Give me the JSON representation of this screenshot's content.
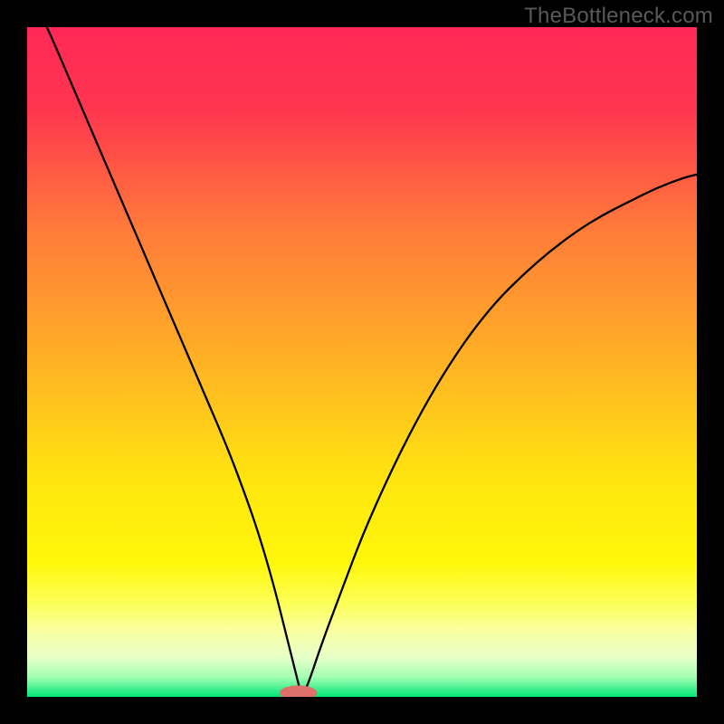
{
  "watermark": "TheBottleneck.com",
  "chart_data": {
    "type": "line",
    "title": "",
    "xlabel": "",
    "ylabel": "",
    "xlim": [
      0,
      100
    ],
    "ylim": [
      0,
      100
    ],
    "grid": false,
    "background_gradient": {
      "direction": "vertical",
      "stops": [
        {
          "offset": 0.0,
          "color": "#ff2856"
        },
        {
          "offset": 0.12,
          "color": "#ff3550"
        },
        {
          "offset": 0.3,
          "color": "#ff7a3a"
        },
        {
          "offset": 0.5,
          "color": "#ffb224"
        },
        {
          "offset": 0.68,
          "color": "#ffe60f"
        },
        {
          "offset": 0.8,
          "color": "#fff70a"
        },
        {
          "offset": 0.86,
          "color": "#fdff58"
        },
        {
          "offset": 0.9,
          "color": "#faffa0"
        },
        {
          "offset": 0.94,
          "color": "#e8ffc8"
        },
        {
          "offset": 0.97,
          "color": "#a6ffb4"
        },
        {
          "offset": 1.0,
          "color": "#00e676"
        }
      ]
    },
    "series": [
      {
        "name": "bottleneck-curve",
        "color": "#000000",
        "stroke_width": 2.3,
        "x": [
          0,
          3,
          6,
          9,
          12,
          15,
          18,
          21,
          24,
          27,
          30,
          33,
          35,
          37,
          38.5,
          40,
          41,
          42,
          44,
          47,
          50,
          54,
          58,
          62,
          66,
          70,
          74,
          78,
          82,
          86,
          90,
          94,
          98,
          100
        ],
        "y": [
          106,
          100,
          93,
          86,
          79,
          72,
          65,
          58,
          51,
          44,
          37,
          29,
          23,
          16,
          10,
          4,
          0,
          2,
          8,
          16,
          24,
          33,
          41,
          48,
          54,
          59,
          63,
          66.5,
          69.5,
          72,
          74,
          76,
          77.5,
          78
        ]
      }
    ],
    "marker": {
      "name": "optimal-lozenge",
      "cx": 40.5,
      "cy": 0.6,
      "rx": 2.8,
      "ry": 1.1,
      "fill": "#de6f6b"
    }
  }
}
